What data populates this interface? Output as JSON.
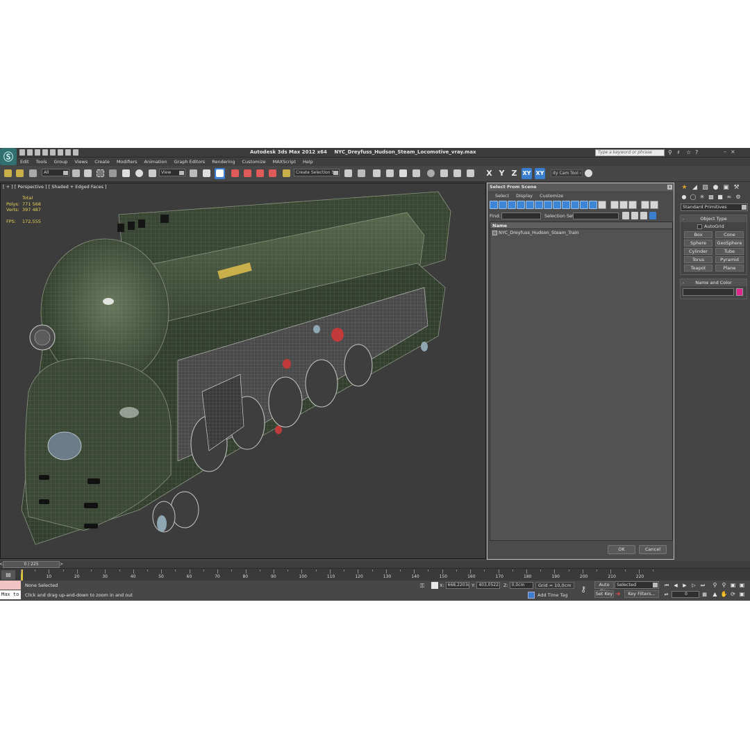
{
  "window": {
    "app_title": "Autodesk 3ds Max  2012 x64",
    "file_name": "NYC_Dreyfuss_Hudson_Steam_Locomotive_vray.max",
    "help_search_placeholder": "Type a keyword or phrase"
  },
  "menu": [
    "Edit",
    "Tools",
    "Group",
    "Views",
    "Create",
    "Modifiers",
    "Animation",
    "Graph Editors",
    "Rendering",
    "Customize",
    "MAXScript",
    "Help"
  ],
  "toolbar": {
    "selection_filter": "All",
    "ref_coord": "View",
    "named_selection": "Create Selection Se",
    "axis_x": "X",
    "axis_y": "Y",
    "axis_z": "Z",
    "axis_xy": "XY",
    "axis_xy2": "XY",
    "cam_tool": "ity Cam Tool ‹"
  },
  "viewport": {
    "label": "[ + ] [ Perspective ] [ Shaded + Edged Faces ]",
    "stats": {
      "total_label": "Total",
      "polys_label": "Polys:",
      "polys_value": "771 568",
      "verts_label": "Verts:",
      "verts_value": "397 487",
      "fps_label": "FPS:",
      "fps_value": "172,555"
    }
  },
  "dialog": {
    "title": "Select From Scene",
    "close": "x",
    "menu": [
      "Select",
      "Display",
      "Customize"
    ],
    "find_label": "Find:",
    "selection_set_label": "Selection Set:",
    "column_name": "Name",
    "items": [
      "NYC_Dreyfuss_Hudson_Steam_Train"
    ],
    "ok": "OK",
    "cancel": "Cancel"
  },
  "command_panel": {
    "dropdown": "Standard Primitives",
    "object_type_title": "Object Type",
    "autogrid": "AutoGrid",
    "primitives": [
      "Box",
      "Cone",
      "Sphere",
      "GeoSphere",
      "Cylinder",
      "Tube",
      "Torus",
      "Pyramid",
      "Teapot",
      "Plane"
    ],
    "name_color_title": "Name and Color",
    "object_color": "#e0258f"
  },
  "timeline": {
    "slider": "0 / 225",
    "arrow_left": "<",
    "arrow_right": ">",
    "ticks": [
      "10",
      "20",
      "30",
      "40",
      "50",
      "60",
      "70",
      "80",
      "90",
      "100",
      "110",
      "120",
      "130",
      "140",
      "150",
      "160",
      "170",
      "180",
      "190",
      "200",
      "210",
      "220"
    ]
  },
  "status": {
    "maxscript_label": "Max to",
    "selection": "None Selected",
    "prompt": "Click and drag up-and-down to zoom in and out",
    "x_label": "X:",
    "x_value": "668,2203c",
    "y_label": "Y:",
    "y_value": "403,05222",
    "z_label": "Z:",
    "z_value": "0,0cm",
    "grid": "Grid = 10,0cm",
    "add_time_tag": "Add Time Tag",
    "auto_key": "Auto Key",
    "set_key": "Set Key",
    "selected": "Selected",
    "key_filters": "Key Filters...",
    "frame": "0"
  },
  "colors": {
    "accent": "#3a7fcf",
    "stats_text": "#e8d25a",
    "loco_body": "#3f4d37"
  }
}
